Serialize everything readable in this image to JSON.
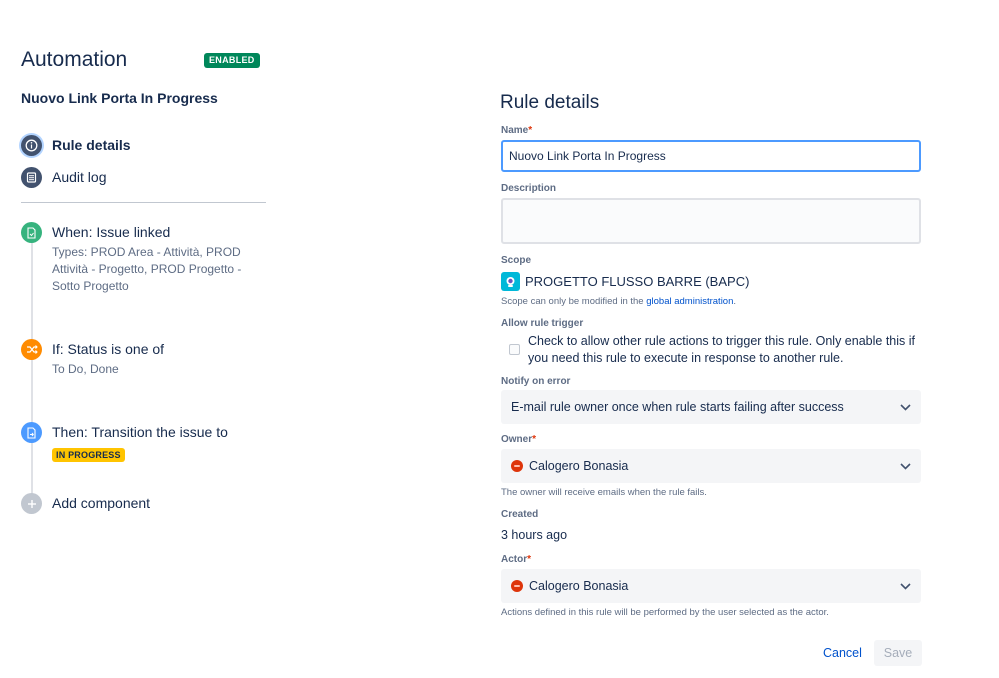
{
  "header": {
    "title": "Automation",
    "status_badge": "ENABLED",
    "rule_name": "Nuovo Link Porta In Progress"
  },
  "nav": {
    "items": [
      {
        "label": "Rule details",
        "icon": "info-icon",
        "active": true
      },
      {
        "label": "Audit log",
        "icon": "list-icon",
        "active": false
      }
    ]
  },
  "steps": {
    "when": {
      "title": "When: Issue linked",
      "subtitle": "Types: PROD Area - Attività, PROD Attività - Progetto, PROD Progetto - Sotto Progetto",
      "icon": "document-icon",
      "color": "#36b37e"
    },
    "if": {
      "title": "If: Status is one of",
      "subtitle": "To Do, Done",
      "icon": "shuffle-icon",
      "color": "#ff8b00"
    },
    "then": {
      "title": "Then: Transition the issue to",
      "status": "IN PROGRESS",
      "icon": "transition-icon",
      "color": "#4c9aff"
    },
    "add": {
      "title": "Add component",
      "icon": "plus-icon",
      "color": "#c1c7d0"
    }
  },
  "form": {
    "title": "Rule details",
    "name": {
      "label": "Name",
      "required": "*",
      "value": "Nuovo Link Porta In Progress"
    },
    "description": {
      "label": "Description",
      "value": ""
    },
    "scope": {
      "label": "Scope",
      "value": "PROGETTO FLUSSO BARRE (BAPC)",
      "help_prefix": "Scope can only be modified in the ",
      "help_link": "global administration",
      "help_suffix": "."
    },
    "allow_trigger": {
      "label": "Allow rule trigger",
      "checked": false,
      "text": "Check to allow other rule actions to trigger this rule. Only enable this if you need this rule to execute in response to another rule."
    },
    "notify": {
      "label": "Notify on error",
      "value": "E-mail rule owner once when rule starts failing after success"
    },
    "owner": {
      "label": "Owner",
      "required": "*",
      "value": "Calogero Bonasia",
      "help": "The owner will receive emails when the rule fails."
    },
    "created": {
      "label": "Created",
      "value": "3 hours ago"
    },
    "actor": {
      "label": "Actor",
      "required": "*",
      "value": "Calogero Bonasia",
      "help": "Actions defined in this rule will be performed by the user selected as the actor."
    },
    "cancel_label": "Cancel",
    "save_label": "Save"
  },
  "colors": {
    "accent": "#0052cc",
    "enabled": "#00875a",
    "in_progress": "#ffc400",
    "required": "#de350b"
  }
}
